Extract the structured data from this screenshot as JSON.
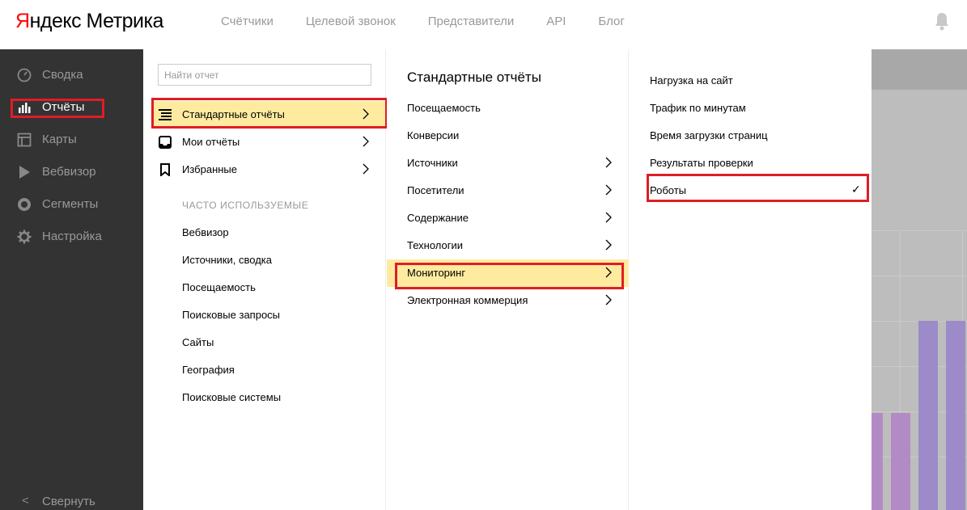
{
  "header": {
    "logo_ya": "Я",
    "logo_rest": "ндекс Метрика",
    "nav": [
      "Счётчики",
      "Целевой звонок",
      "Представители",
      "API",
      "Блог"
    ],
    "bell_icon": "bell-icon"
  },
  "sidebar": {
    "items": [
      {
        "label": "Сводка",
        "icon": "gauge-icon"
      },
      {
        "label": "Отчёты",
        "icon": "bar-chart-icon",
        "active": true
      },
      {
        "label": "Карты",
        "icon": "layout-icon"
      },
      {
        "label": "Вебвизор",
        "icon": "play-icon"
      },
      {
        "label": "Сегменты",
        "icon": "pie-icon"
      },
      {
        "label": "Настройка",
        "icon": "gear-icon"
      }
    ],
    "collapse_arrow": "<",
    "collapse_label": "Свернуть"
  },
  "reports_menu": {
    "search_placeholder": "Найти отчет",
    "items": [
      {
        "label": "Стандартные отчёты",
        "icon": "list-icon",
        "active": true
      },
      {
        "label": "Мои отчёты",
        "icon": "inbox-icon"
      },
      {
        "label": "Избранные",
        "icon": "bookmark-icon"
      }
    ],
    "frequent_title": "ЧАСТО ИСПОЛЬЗУЕМЫЕ",
    "frequent": [
      "Вебвизор",
      "Источники, сводка",
      "Посещаемость",
      "Поисковые запросы",
      "Сайты",
      "География",
      "Поисковые системы"
    ]
  },
  "standard_reports": {
    "title": "Стандартные отчёты",
    "items": [
      {
        "label": "Посещаемость",
        "submenu": false
      },
      {
        "label": "Конверсии",
        "submenu": false
      },
      {
        "label": "Источники",
        "submenu": true
      },
      {
        "label": "Посетители",
        "submenu": true
      },
      {
        "label": "Содержание",
        "submenu": true
      },
      {
        "label": "Технологии",
        "submenu": true
      },
      {
        "label": "Мониторинг",
        "submenu": true,
        "active": true
      },
      {
        "label": "Электронная коммерция",
        "submenu": true
      }
    ]
  },
  "monitoring": {
    "items": [
      {
        "label": "Нагрузка на сайт"
      },
      {
        "label": "Трафик по минутам"
      },
      {
        "label": "Время загрузки страниц"
      },
      {
        "label": "Результаты проверки"
      },
      {
        "label": "Роботы",
        "checked": true,
        "check_mark": "✓"
      }
    ]
  },
  "colors": {
    "highlight": "#ffeba0",
    "annotation_red": "#e01c24",
    "sidebar_bg": "#333333",
    "bar_pink": "#b38bc4",
    "bar_purple": "#9c8bc8"
  }
}
